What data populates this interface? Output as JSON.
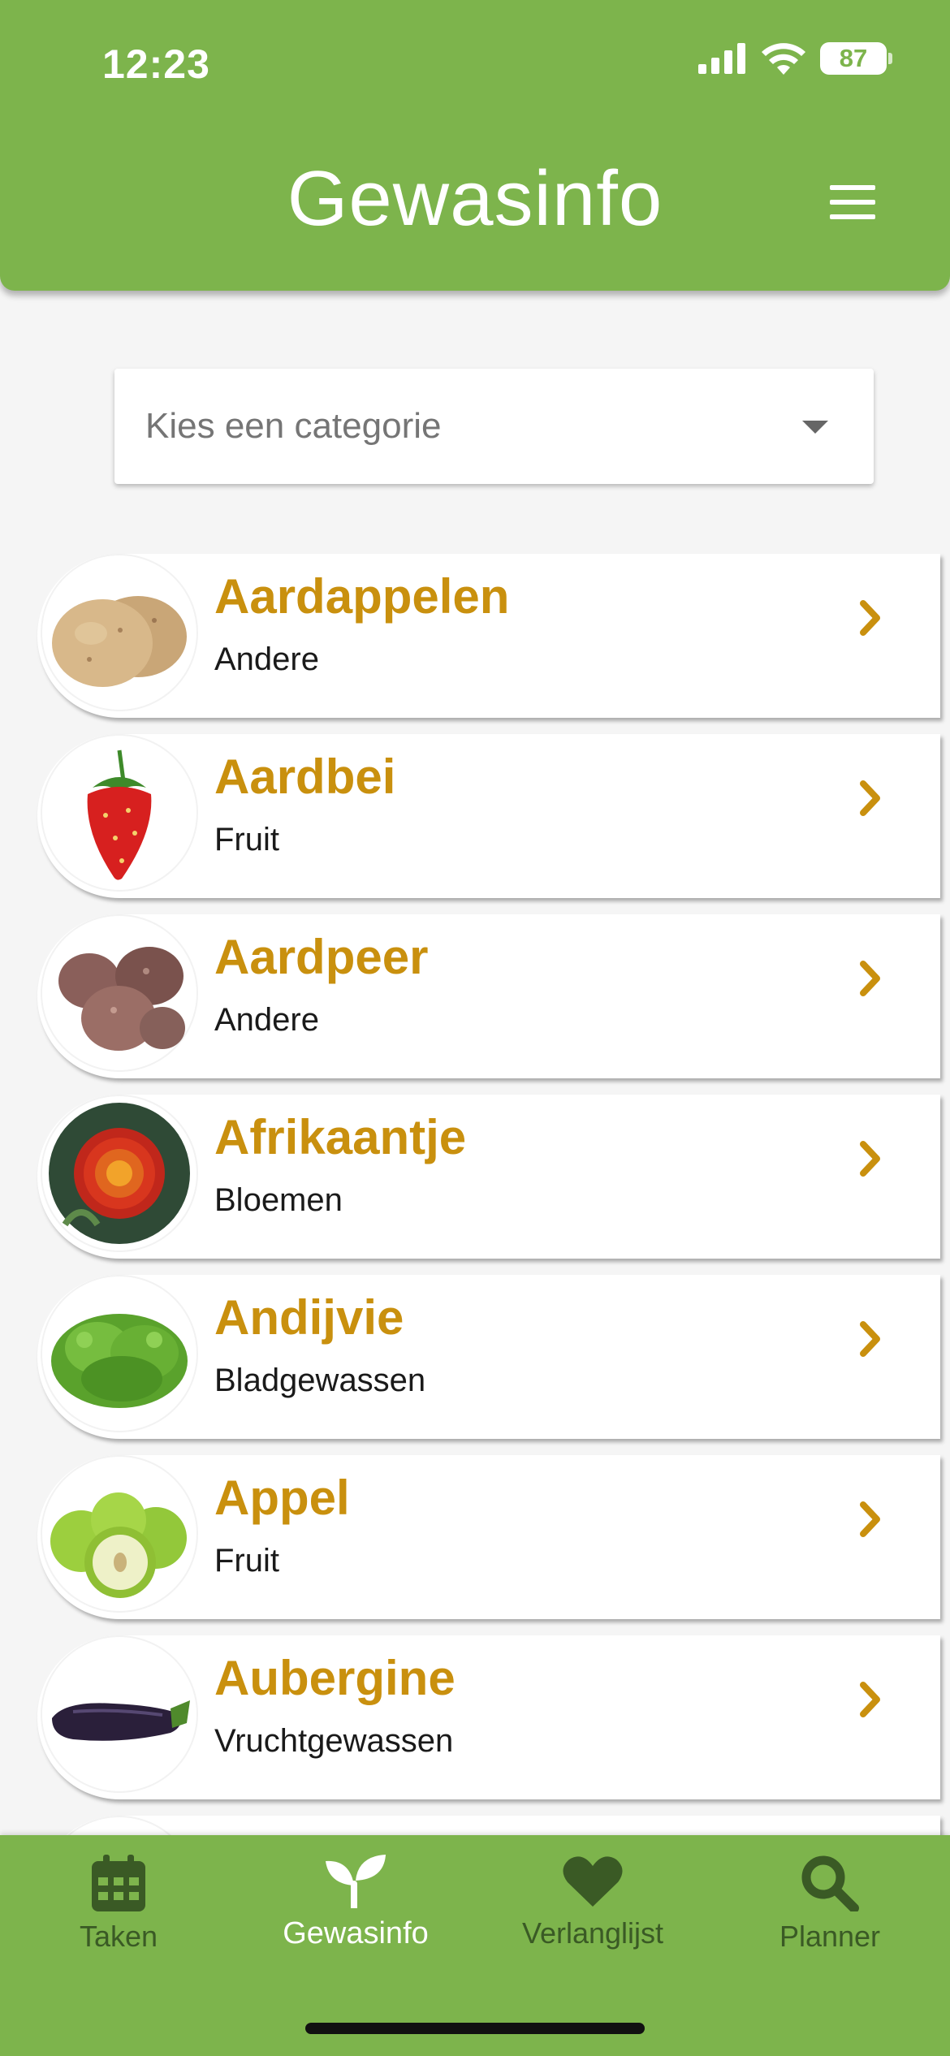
{
  "status_bar": {
    "time": "12:23",
    "battery": "87"
  },
  "header": {
    "title": "Gewasinfo"
  },
  "category_select": {
    "placeholder": "Kies een categorie"
  },
  "crops": [
    {
      "name": "Aardappelen",
      "category": "Andere",
      "icon": "potato-image"
    },
    {
      "name": "Aardbei",
      "category": "Fruit",
      "icon": "strawberry-image"
    },
    {
      "name": "Aardpeer",
      "category": "Andere",
      "icon": "jerusalem-artichoke-image"
    },
    {
      "name": "Afrikaantje",
      "category": "Bloemen",
      "icon": "marigold-image"
    },
    {
      "name": "Andijvie",
      "category": "Bladgewassen",
      "icon": "endive-image"
    },
    {
      "name": "Appel",
      "category": "Fruit",
      "icon": "apple-image"
    },
    {
      "name": "Aubergine",
      "category": "Vruchtgewassen",
      "icon": "eggplant-image"
    }
  ],
  "bottom_nav": {
    "items": [
      {
        "label": "Taken",
        "icon": "calendar-icon"
      },
      {
        "label": "Gewasinfo",
        "icon": "sprout-icon",
        "active": true
      },
      {
        "label": "Verlanglijst",
        "icon": "heart-icon"
      },
      {
        "label": "Planner",
        "icon": "search-icon"
      }
    ]
  },
  "colors": {
    "primary": "#7db44c",
    "accent": "#c9900e",
    "nav_inactive": "#3a5a25"
  }
}
